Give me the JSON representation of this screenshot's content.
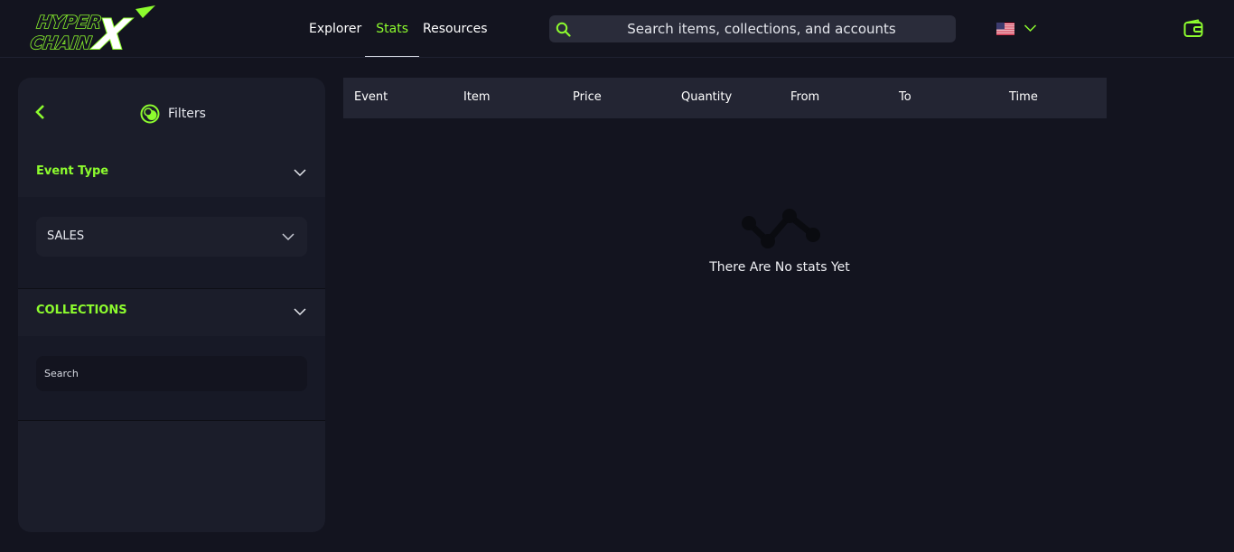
{
  "header": {
    "logo_text": [
      "HYPER",
      "CHAIN",
      "X"
    ],
    "nav": [
      {
        "label": "Explorer",
        "active": false
      },
      {
        "label": "Stats",
        "active": true
      },
      {
        "label": "Resources",
        "active": false
      }
    ],
    "search": {
      "placeholder": "Search items, collections, and accounts",
      "icon": "search-icon"
    },
    "language": {
      "flag": "us-flag-icon",
      "chevron": "chevron-down-icon"
    },
    "wallet_icon": "wallet-icon"
  },
  "sidebar": {
    "title": "Filters",
    "back_icon": "chevron-left-icon",
    "filters_icon": "filters-icon",
    "event_type": {
      "label": "Event Type",
      "selected": "SALES"
    },
    "collections": {
      "label": "COLLECTIONS",
      "search_placeholder": "Search"
    }
  },
  "table": {
    "columns": [
      "Event",
      "Item",
      "Price",
      "Quantity",
      "From",
      "To",
      "Time"
    ]
  },
  "empty_state": {
    "icon": "stats-line-icon",
    "message": "There Are No stats Yet"
  },
  "colors": {
    "accent": "#8dfc2e",
    "background": "#13141f",
    "panel": "#1b1d2a",
    "table_header": "#232533"
  }
}
